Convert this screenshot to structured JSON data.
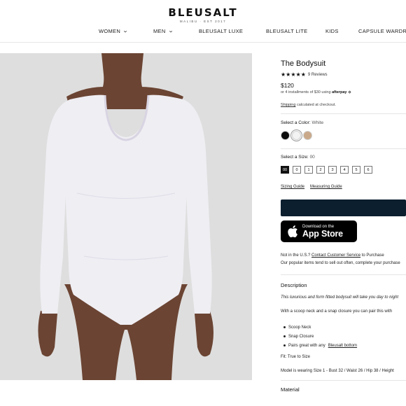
{
  "header": {
    "logo": "BLEUSALT",
    "logo_sub": "MALIBU · EST 2017",
    "nav": [
      {
        "label": "WOMEN",
        "has_dropdown": true
      },
      {
        "label": "MEN",
        "has_dropdown": true
      },
      {
        "label": "BLEUSALT LUXE",
        "has_dropdown": false
      },
      {
        "label": "BLEUSALT LITE",
        "has_dropdown": false
      },
      {
        "label": "KIDS",
        "has_dropdown": false
      },
      {
        "label": "CAPSULE WARDROBE",
        "has_dropdown": false
      }
    ]
  },
  "product": {
    "title": "The Bodysuit",
    "stars": "★★★★★",
    "reviews": "9 Reviews",
    "price": "$120",
    "afterpay_prefix": "or 4 installments of $30 using",
    "afterpay_brand": "afterpay",
    "afterpay_icon": "afterpay-badge-icon",
    "shipping_link": "Shipping",
    "shipping_text": "calculated at checkout."
  },
  "color": {
    "label": "Select a Color:",
    "value": "White",
    "swatches": [
      {
        "name": "Black",
        "hex": "#0d0d0d",
        "selected": false
      },
      {
        "name": "White",
        "hex": "#f3f3f3",
        "selected": true
      },
      {
        "name": "Tan",
        "hex": "#c9a98a",
        "selected": false
      }
    ]
  },
  "size": {
    "label": "Select a Size:",
    "value": "00",
    "options": [
      "00",
      "0",
      "1",
      "2",
      "3",
      "4",
      "5",
      "6"
    ],
    "selected": "00"
  },
  "guides": {
    "sizing": "Sizing Guide",
    "measuring": "Measuring Guide"
  },
  "app_store": {
    "small": "Download on the",
    "big": "App Store",
    "icon": "apple-icon"
  },
  "notice": {
    "prefix": "Not in the U.S.?",
    "link": "Contact Customer Service",
    "suffix": "to Purchase",
    "line2": "Our popular items tend to sell out often, complete your purchase"
  },
  "description": {
    "heading": "Description",
    "p1": "This luxurious and form fitted bodysuit will take you day to night",
    "p2": "With a scoop neck and a snap closure you can pair this with",
    "bullets": [
      "Scoop Neck",
      "Snap Closure"
    ],
    "bullet3_prefix": "Pairs great with any",
    "bullet3_link": "Bleusalt bottom",
    "fit": "Fit: True to Size",
    "model": "Model is wearing Size 1 - Bust 32 / Waist 26 / Hip 38 / Height"
  },
  "material": {
    "heading": "Material"
  },
  "colors": {
    "button_dark": "#0b1f2e",
    "image_bg": "#dcdcdc"
  }
}
